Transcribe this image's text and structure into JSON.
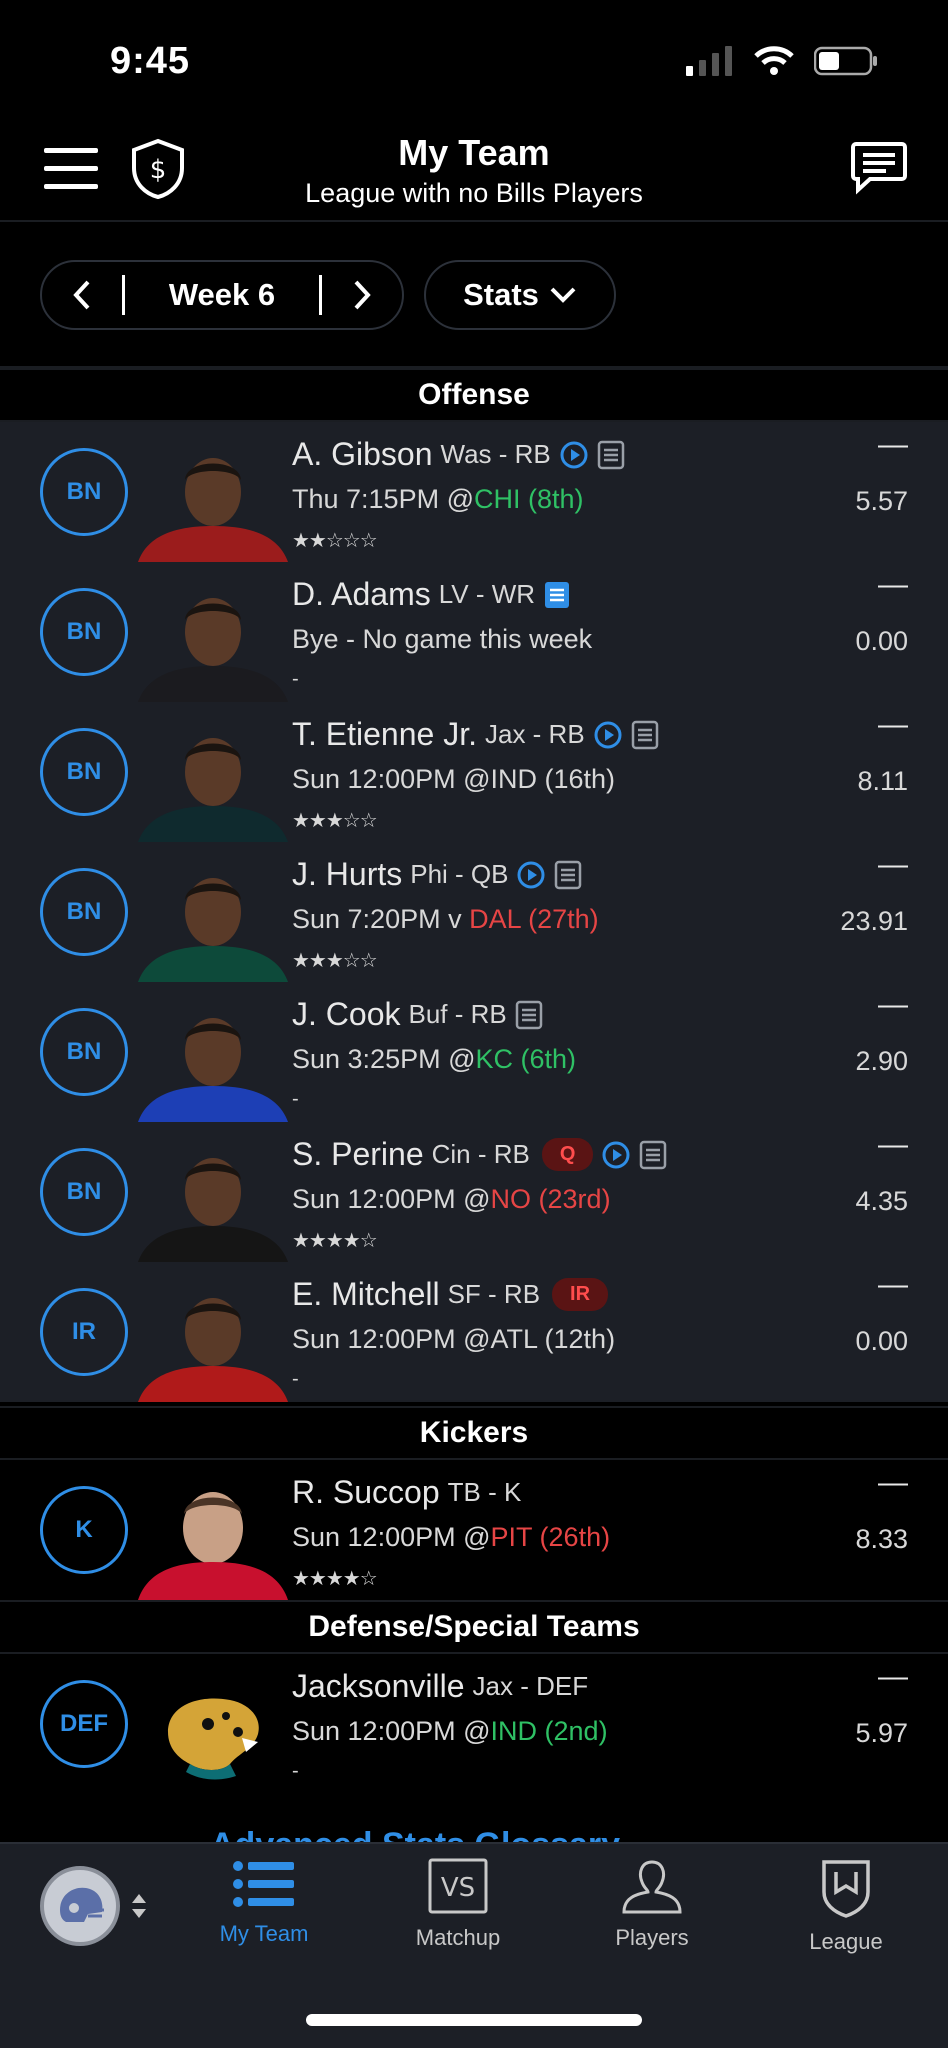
{
  "status": {
    "time": "9:45"
  },
  "header": {
    "title": "My Team",
    "subtitle": "League with no Bills Players"
  },
  "controls": {
    "week_label": "Week 6",
    "stats_label": "Stats"
  },
  "sections": {
    "offense": "Offense",
    "kickers": "Kickers",
    "defense": "Defense/Special Teams"
  },
  "players": [
    {
      "slot": "BN",
      "name": "A. Gibson",
      "meta": "Was - RB",
      "game_prefix": "Thu 7:15PM @",
      "opponent": "CHI (8th)",
      "opp_class": "good",
      "stars": "★★☆☆☆",
      "dash": "—",
      "points": "5.57",
      "icons": [
        "play-icon",
        "news-icon"
      ],
      "jersey": "#9b1c1c"
    },
    {
      "slot": "BN",
      "name": "D. Adams",
      "meta": "LV - WR",
      "game_prefix": "Bye - No game this week",
      "opponent": "",
      "opp_class": "",
      "stars": "-",
      "dash": "—",
      "points": "0.00",
      "icons": [
        "news-icon-blue"
      ],
      "jersey": "#1b1b1f"
    },
    {
      "slot": "BN",
      "name": "T. Etienne Jr.",
      "meta": "Jax - RB",
      "game_prefix": "Sun 12:00PM @IND (16th)",
      "opponent": "",
      "opp_class": "",
      "stars": "★★★☆☆",
      "dash": "—",
      "points": "8.11",
      "icons": [
        "play-icon",
        "news-icon"
      ],
      "jersey": "#0f2a2e"
    },
    {
      "slot": "BN",
      "name": "J. Hurts",
      "meta": "Phi - QB",
      "game_prefix": "Sun 7:20PM v ",
      "opponent": "DAL (27th)",
      "opp_class": "bad",
      "stars": "★★★☆☆",
      "dash": "—",
      "points": "23.91",
      "icons": [
        "play-icon",
        "news-icon"
      ],
      "jersey": "#0d4a3a"
    },
    {
      "slot": "BN",
      "name": "J. Cook",
      "meta": "Buf - RB",
      "game_prefix": "Sun 3:25PM @",
      "opponent": "KC (6th)",
      "opp_class": "good",
      "stars": "-",
      "dash": "—",
      "points": "2.90",
      "icons": [
        "news-icon"
      ],
      "jersey": "#1d3fb5"
    },
    {
      "slot": "BN",
      "name": "S. Perine",
      "meta": "Cin - RB",
      "badge": "Q",
      "game_prefix": "Sun 12:00PM @",
      "opponent": "NO (23rd)",
      "opp_class": "bad",
      "stars": "★★★★☆",
      "dash": "—",
      "points": "4.35",
      "icons": [
        "play-icon",
        "news-icon"
      ],
      "jersey": "#151515"
    },
    {
      "slot": "IR",
      "name": "E. Mitchell",
      "meta": "SF - RB",
      "badge": "IR",
      "game_prefix": "Sun 12:00PM @ATL (12th)",
      "opponent": "",
      "opp_class": "",
      "stars": "-",
      "dash": "—",
      "points": "0.00",
      "icons": [],
      "jersey": "#b01a1a"
    }
  ],
  "kicker": {
    "slot": "K",
    "name": "R. Succop",
    "meta": "TB - K",
    "game_prefix": "Sun 12:00PM @",
    "opponent": "PIT (26th)",
    "opp_class": "bad",
    "stars": "★★★★☆",
    "dash": "—",
    "points": "8.33"
  },
  "defense": {
    "slot": "DEF",
    "name": "Jacksonville",
    "meta": "Jax - DEF",
    "game_prefix": "Sun 12:00PM @",
    "opponent": "IND (2nd)",
    "opp_class": "good",
    "stars": "-",
    "dash": "—",
    "points": "5.97"
  },
  "advanced_link": "Advanced Stats Glossary",
  "tabs": [
    {
      "label": "My Team",
      "icon": "list-icon",
      "active": true
    },
    {
      "label": "Matchup",
      "icon": "vs-icon",
      "active": false
    },
    {
      "label": "Players",
      "icon": "person-icon",
      "active": false
    },
    {
      "label": "League",
      "icon": "league-shield-icon",
      "active": false
    }
  ],
  "colors": {
    "accent": "#2f8ee6",
    "good": "#2fc165",
    "bad": "#e64545",
    "bench_bg": "#1c1f26"
  }
}
